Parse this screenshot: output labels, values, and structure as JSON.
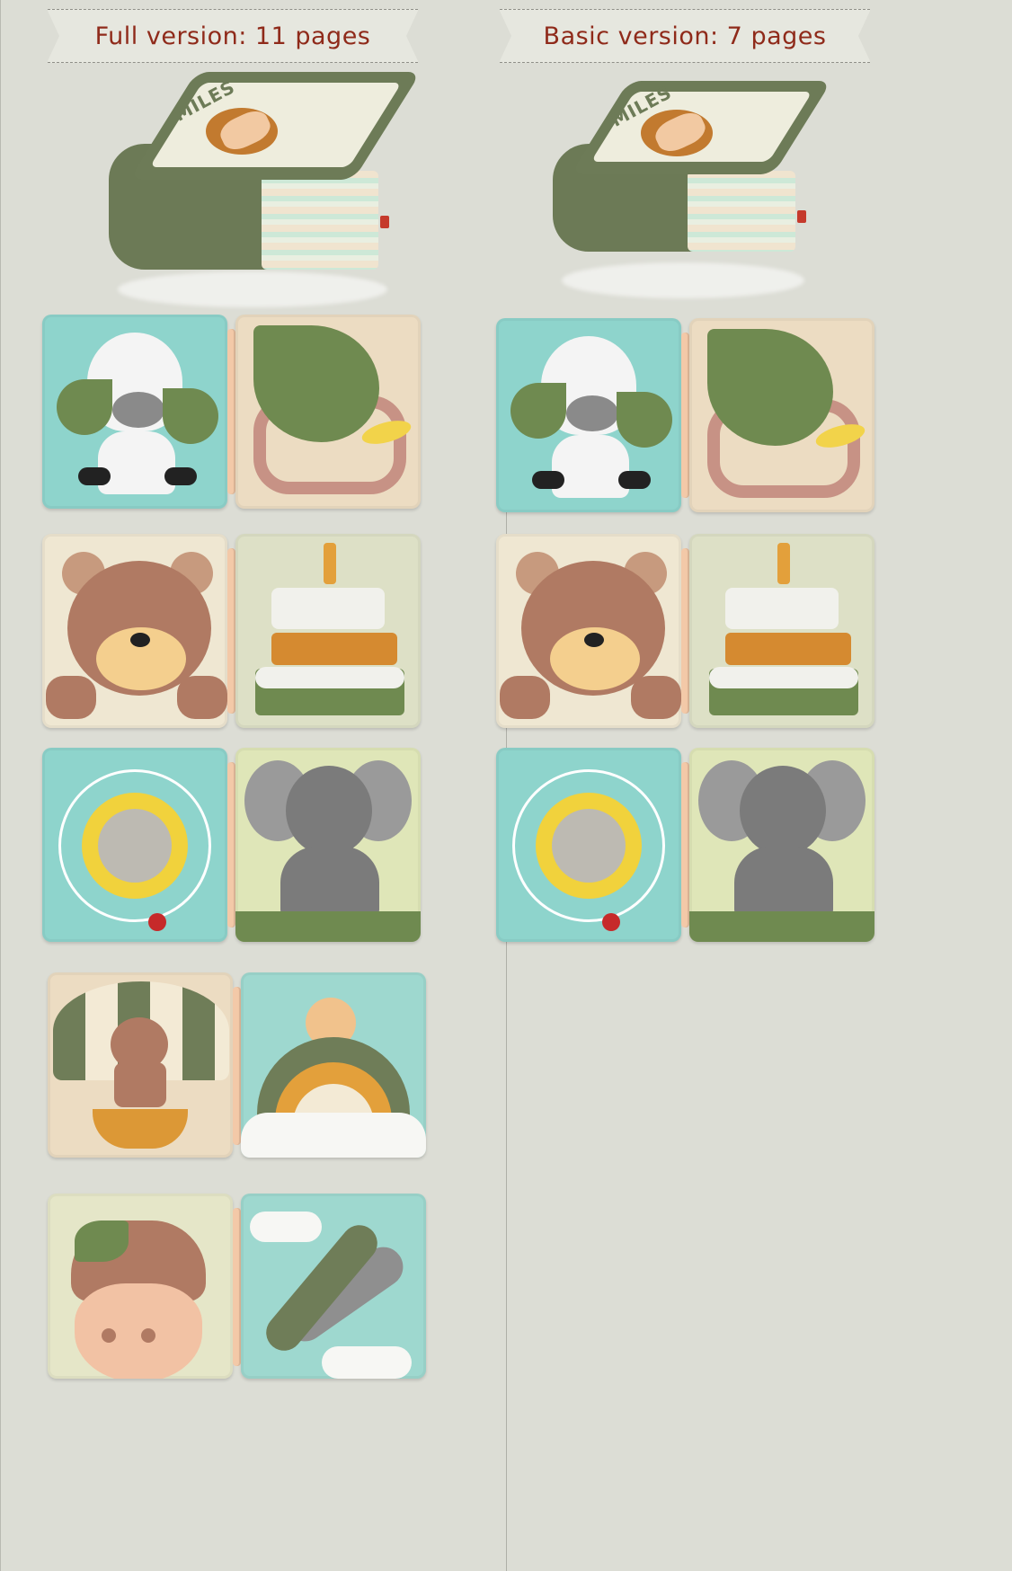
{
  "columns": [
    {
      "banner": "Full version: 11 pages",
      "cover_title": "MILES",
      "spreads": [
        "zebra-monkey",
        "bear-cake",
        "sun-mirror-elephant",
        "hot-air-balloon",
        "acorn-airplane"
      ]
    },
    {
      "banner": "Basic version: 7 pages",
      "cover_title": "MILES",
      "spreads": [
        "zebra-monkey",
        "bear-cake",
        "sun-mirror-elephant"
      ]
    }
  ],
  "colors": {
    "banner_text": "#8f2a1a",
    "background": "#dcddd5",
    "felt_green": "#6d7b57"
  }
}
